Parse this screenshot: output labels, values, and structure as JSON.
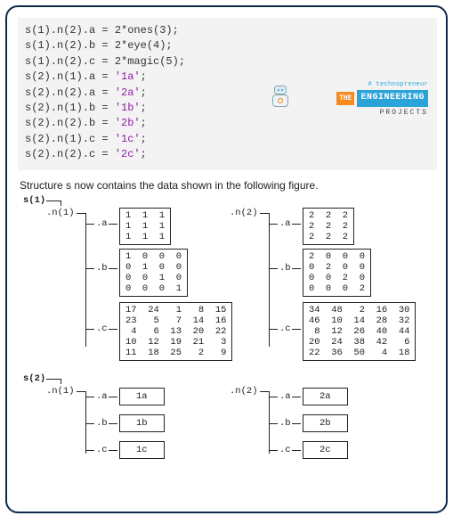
{
  "code": {
    "l1": "s(1).n(2).a = 2*ones(3);",
    "l2": "s(1).n(2).b = 2*eye(4);",
    "l3": "s(1).n(2).c = 2*magic(5);",
    "l4": "",
    "l5p": "s(2).n(1).a = ",
    "l5s": "'1a'",
    "l6p": "s(2).n(2).a = ",
    "l6s": "'2a'",
    "l7p": "s(2).n(1).b = ",
    "l7s": "'1b'",
    "l8p": "s(2).n(2).b = ",
    "l8s": "'2b'",
    "l9p": "s(2).n(1).c = ",
    "l9s": "'1c'",
    "l10p": "s(2).n(2).c = ",
    "l10s": "'2c'",
    "semi": ";"
  },
  "logo": {
    "hash": "# technopreneur",
    "the": "THE",
    "eng": "ENGINEERING",
    "proj": "PROJECTS"
  },
  "caption": "Structure s now contains the data shown in the following figure.",
  "labels": {
    "s1": "s(1)",
    "s2": "s(2)",
    "n1": ".n(1)",
    "n2": ".n(2)",
    "a": ".a",
    "b": ".b",
    "c": ".c"
  },
  "matrices": {
    "s1n1a": "1  1  1\n1  1  1\n1  1  1",
    "s1n1b": "1  0  0  0\n0  1  0  0\n0  0  1  0\n0  0  0  1",
    "s1n1c": "17  24   1   8  15\n23   5   7  14  16\n 4   6  13  20  22\n10  12  19  21   3\n11  18  25   2   9",
    "s1n2a": "2  2  2\n2  2  2\n2  2  2",
    "s1n2b": "2  0  0  0\n0  2  0  0\n0  0  2  0\n0  0  0  2",
    "s1n2c": "34  48   2  16  30\n46  10  14  28  32\n 8  12  26  40  44\n20  24  38  42   6\n22  36  50   4  18",
    "s2n1a": "1a",
    "s2n1b": "1b",
    "s2n1c": "1c",
    "s2n2a": "2a",
    "s2n2b": "2b",
    "s2n2c": "2c"
  }
}
